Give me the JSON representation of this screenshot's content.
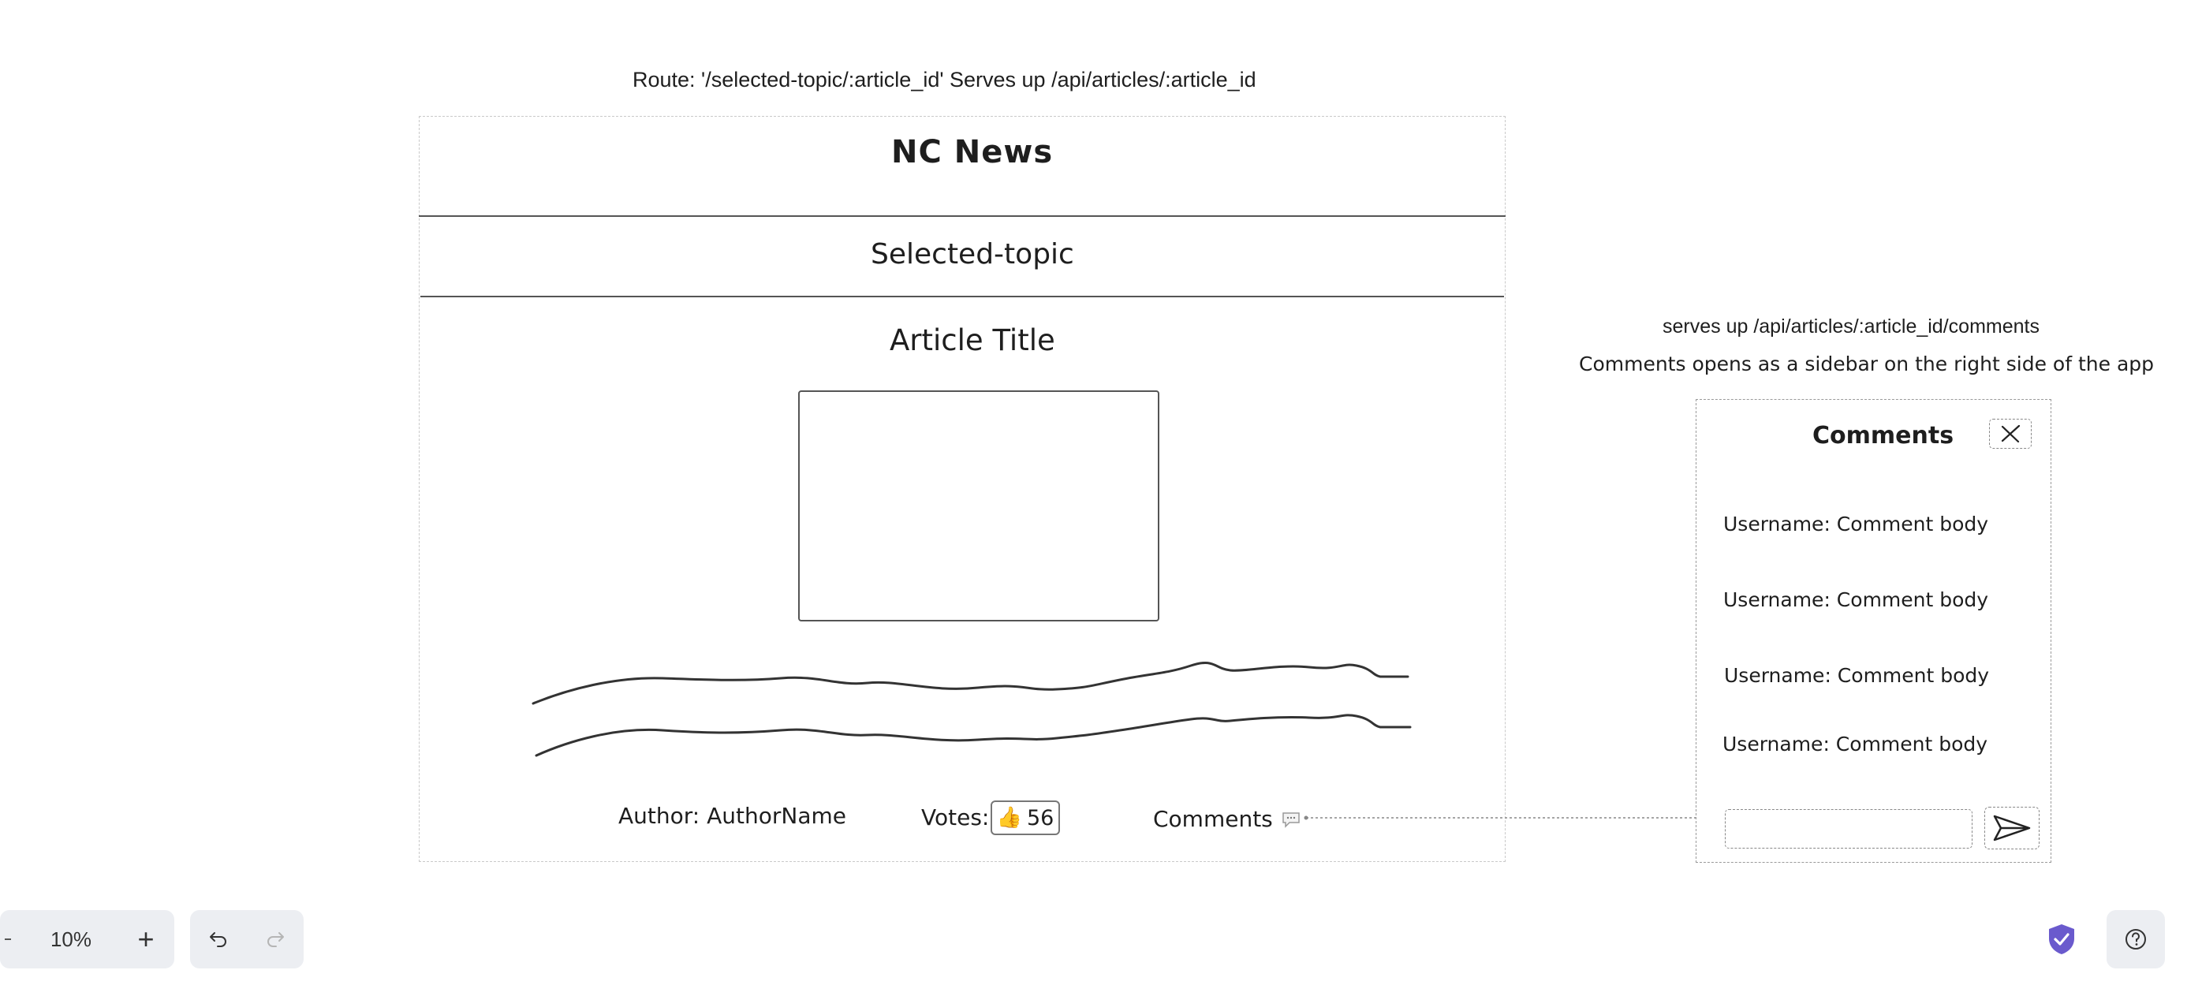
{
  "canvas": {
    "route_label": "Route: '/selected-topic/:article_id' Serves up /api/articles/:article_id",
    "comments_api_label": "serves up /api/articles/:article_id/comments",
    "sidebar_note": "Comments opens as a sidebar on the right side of the app"
  },
  "article_page": {
    "app_title": "NC News",
    "topic_title": "Selected-topic",
    "article_title": "Article Title",
    "author_label": "Author: AuthorName",
    "votes_label": "Votes:",
    "votes_icon": "thumbs-up-icon",
    "votes_count": "56",
    "comments_label": "Comments",
    "comments_icon": "speech-bubble-icon"
  },
  "comments_sidebar": {
    "title": "Comments",
    "comments": [
      "Username: Comment body",
      "Username: Comment body",
      "Username: Comment body",
      "Username: Comment body"
    ],
    "input_value": "",
    "send_icon": "send-arrow-icon",
    "close_icon": "close-icon"
  },
  "toolbar": {
    "zoom_level": "10%",
    "zoom_in_label": "+",
    "undo_icon": "undo-icon",
    "redo_icon": "redo-icon",
    "help_icon": "help-icon",
    "shield_icon": "shield-check-icon",
    "shield_color": "#6a5acd"
  }
}
